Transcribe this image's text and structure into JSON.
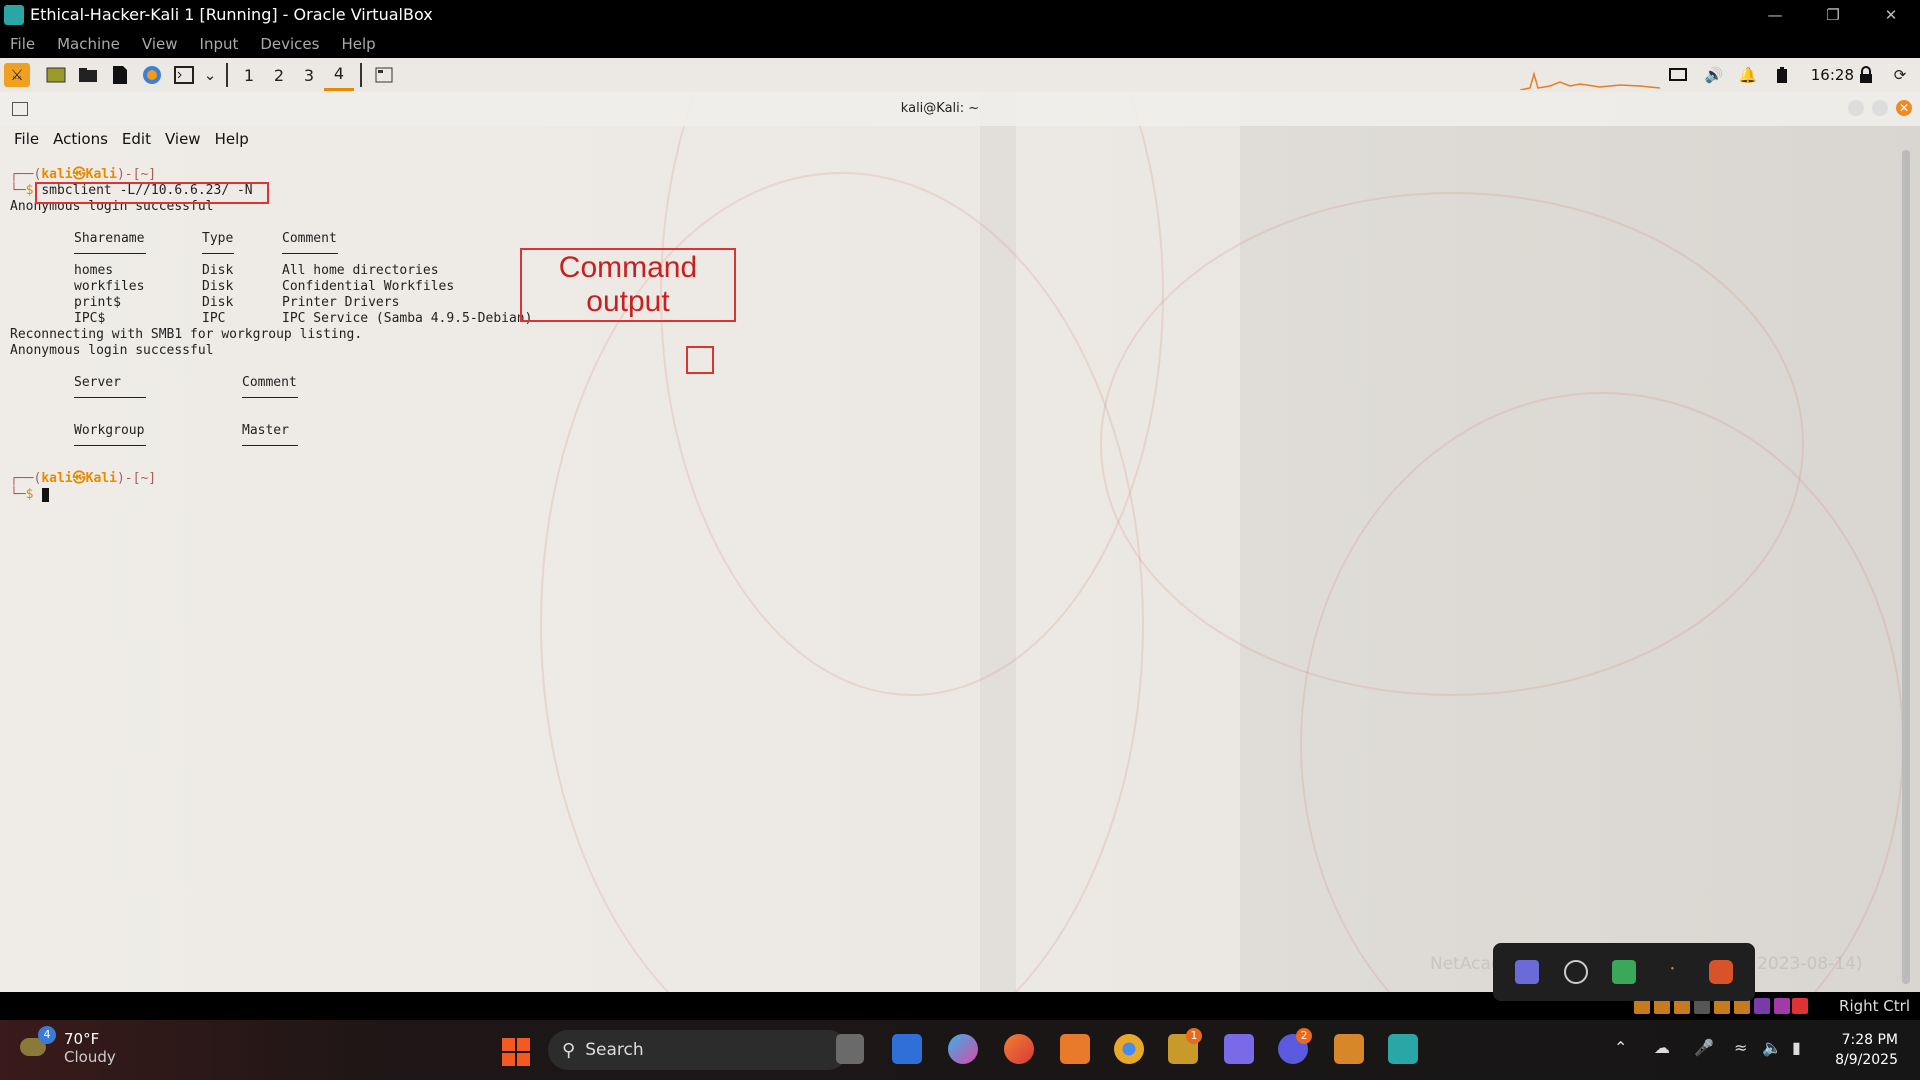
{
  "vbox": {
    "title": "Ethical-Hacker-Kali 1 [Running] - Oracle VirtualBox",
    "menu": [
      "File",
      "Machine",
      "View",
      "Input",
      "Devices",
      "Help"
    ]
  },
  "panel": {
    "workspaces": [
      "1",
      "2",
      "3",
      "4"
    ],
    "active_workspace": "4",
    "clock": "16:28"
  },
  "terminal": {
    "title": "kali@Kali: ~",
    "menu": [
      "File",
      "Actions",
      "Edit",
      "View",
      "Help"
    ],
    "prompt_top": "(kali㉿Kali)-[~]",
    "prompt_user": "kali",
    "prompt_host": "Kali",
    "prompt_dir": "~",
    "command": "smbclient -L//10.6.6.23/ -N",
    "output": {
      "anon_login": "Anonymous login successful",
      "share_headers": [
        "Sharename",
        "Type",
        "Comment"
      ],
      "shares": [
        {
          "name": "homes",
          "type": "Disk",
          "comment": "All home directories"
        },
        {
          "name": "workfiles",
          "type": "Disk",
          "comment": "Confidential Workfiles"
        },
        {
          "name": "print$",
          "type": "Disk",
          "comment": "Printer Drivers"
        },
        {
          "name": "IPC$",
          "type": "IPC",
          "comment": "IPC Service (Samba 4.9.5-Debian)"
        }
      ],
      "reconnect": "Reconnecting with SMB1 for workgroup listing.",
      "anon_login2": "Anonymous login successful",
      "server_headers": [
        "Server",
        "Comment"
      ],
      "workgroup_headers": [
        "Workgroup",
        "Master"
      ]
    }
  },
  "annotation": {
    "callout": "Command output"
  },
  "desktop": {
    "watermark": "NetAcad Ethical Hacker Kali VM (Build 2023-08-14)"
  },
  "vm_status": {
    "host_key": "Right Ctrl"
  },
  "taskbar": {
    "weather_badge": "4",
    "temperature": "70°F",
    "condition": "Cloudy",
    "search_label": "Search",
    "badges": {
      "teams": "1",
      "whatsapp": "2"
    },
    "time": "7:28 PM",
    "date": "8/9/2025"
  },
  "colors": {
    "accent_orange": "#e68a00",
    "annotation_red": "#d33333",
    "taskbar_bg": "#161616"
  }
}
